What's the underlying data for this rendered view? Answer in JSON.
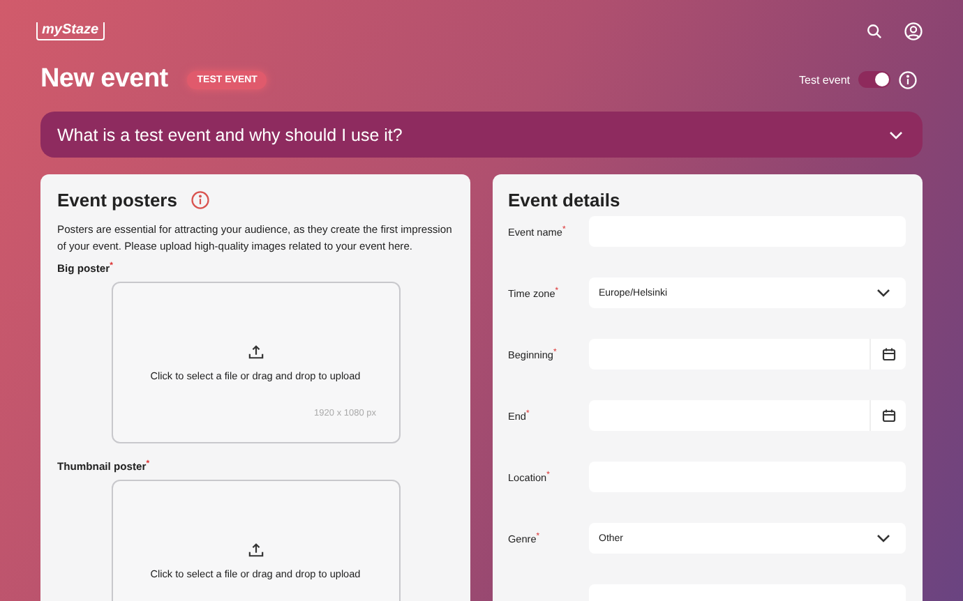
{
  "header": {
    "logo": "myStaze"
  },
  "page": {
    "title": "New event",
    "badge": "TEST EVENT",
    "test_toggle": {
      "label": "Test event",
      "on": true
    }
  },
  "accordion": {
    "title": "What is a test event and why should I use it?",
    "expanded": false
  },
  "posters": {
    "title": "Event posters",
    "description": "Posters are essential for attracting your audience, as they create the first impression of your event. Please upload high-quality images related to your event here.",
    "uploads": [
      {
        "label": "Big poster",
        "required_mark": "*",
        "prompt": "Click to select a file or drag and drop to upload",
        "size_hint": "1920 x 1080 px"
      },
      {
        "label": "Thumbnail poster",
        "required_mark": "*",
        "prompt": "Click to select a file or drag and drop to upload"
      }
    ]
  },
  "details": {
    "title": "Event details",
    "fields": [
      {
        "kind": "text",
        "label": "Event name",
        "required_mark": "*"
      },
      {
        "kind": "select",
        "label": "Time zone",
        "required_mark": "*",
        "value": "Europe/Helsinki"
      },
      {
        "kind": "date",
        "label": "Beginning",
        "required_mark": "*"
      },
      {
        "kind": "date",
        "label": "End",
        "required_mark": "*"
      },
      {
        "kind": "text",
        "label": "Location",
        "required_mark": "*"
      },
      {
        "kind": "select",
        "label": "Genre",
        "required_mark": "*",
        "value": "Other"
      },
      {
        "kind": "text"
      }
    ]
  }
}
